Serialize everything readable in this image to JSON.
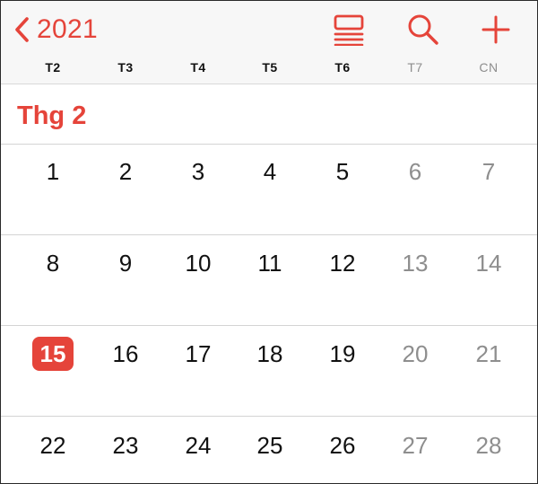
{
  "nav": {
    "back_label": "2021"
  },
  "colors": {
    "accent": "#e5443a",
    "weekend_text": "#8e8e8e",
    "text": "#111111"
  },
  "weekdays": [
    "T2",
    "T3",
    "T4",
    "T5",
    "T6",
    "T7",
    "CN"
  ],
  "month": {
    "title": "Thg 2"
  },
  "weeks": [
    [
      "1",
      "2",
      "3",
      "4",
      "5",
      "6",
      "7"
    ],
    [
      "8",
      "9",
      "10",
      "11",
      "12",
      "13",
      "14"
    ],
    [
      "15",
      "16",
      "17",
      "18",
      "19",
      "20",
      "21"
    ],
    [
      "22",
      "23",
      "24",
      "25",
      "26",
      "27",
      "28"
    ]
  ],
  "today": "15"
}
